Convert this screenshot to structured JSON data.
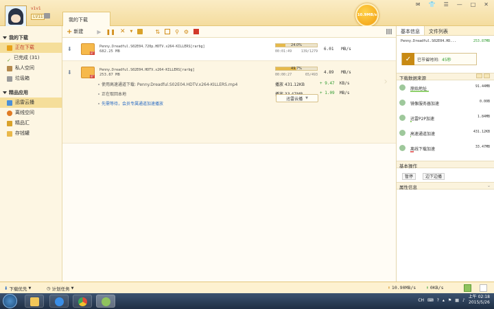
{
  "header": {
    "username": "v1v1",
    "level": "LV11",
    "tab_title": "我的下载",
    "speed_badge": "10.9MB/s",
    "window_controls": [
      "✉",
      "👕",
      "☰",
      "—",
      "□",
      "✕"
    ]
  },
  "sidebar": {
    "group_downloads": "我的下载",
    "items_downloads": [
      {
        "label": "正在下载",
        "active": true
      },
      {
        "label": "已完成 (31)",
        "active": false
      },
      {
        "label": "私人空间",
        "active": false
      },
      {
        "label": "垃圾箱",
        "active": false
      }
    ],
    "group_apps": "精品应用",
    "items_apps": [
      {
        "label": "迅雷云播",
        "active": true
      },
      {
        "label": "离线空间",
        "active": false
      },
      {
        "label": "精品汇",
        "active": false
      },
      {
        "label": "存钱罐",
        "active": false
      }
    ]
  },
  "toolbar": {
    "new_label": "新建"
  },
  "tasks": [
    {
      "name": "Penny.Dreadful.S02E04.720p.HDTV.x264-KILLERS[rarbg]",
      "size": "682.25 MB",
      "progress": 24.0,
      "percent_label": "24.0%",
      "elapsed": "00:01:49",
      "pieces": "139/1279",
      "speed_value": "6.01",
      "speed_unit": "MB/s"
    },
    {
      "name": "Penny.Dreadful.S02E04.HDTV.x264-KILLERS[rarbg]",
      "size": "253.87 MB",
      "progress": 49.7,
      "percent_label": "49.7%",
      "elapsed": "00:00:27",
      "pieces": "65/493",
      "speed_value": "4.89",
      "speed_unit": "MB/s",
      "sub_lines": [
        "使用高速通道下载: Penny.Dreadful.S02E04.HDTV.x264-KILLERS.mp4",
        "正在取回本地",
        "先需等待，会员专属通道加速播放"
      ],
      "accel_rows": [
        {
          "label": "播放 431.12KB",
          "plus": "+ 9.47",
          "unit": "KB/s"
        },
        {
          "label": "播放 33.47MB",
          "plus": "+ 1.09",
          "unit": "MB/s"
        }
      ],
      "cloud_button": "迅雷云播"
    }
  ],
  "right_panel": {
    "tab_basic": "基本信息",
    "tab_files": "文件列表",
    "file_name": "Penny.Dreadful.S02E04.HD...",
    "file_speed": "253.87MB",
    "saved_label": "已节省时间:",
    "saved_value": "45秒",
    "source_header": "下载数据来源",
    "sources": [
      {
        "name": "原始地址",
        "value": "91.44MB",
        "bar": 0.45,
        "color": "#8fd16b"
      },
      {
        "name": "镜像服务器加速",
        "value": "0.00B",
        "bar": 0.0,
        "color": "#8fd16b"
      },
      {
        "name": "迅雷P2P加速",
        "value": "1.84MB",
        "bar": 0.03,
        "color": "#8fd16b"
      },
      {
        "name": "高速通道加速",
        "value": "431.12KB",
        "bar": 0.01,
        "color": "#8fd16b"
      },
      {
        "name": "离线下载加速",
        "value": "33.47MB",
        "bar": 0.09,
        "color": "#e86b6b"
      }
    ],
    "ops_header": "基本操作",
    "pause_btn": "暂停",
    "play_btn": "边下边播",
    "attr_header": "属性信息"
  },
  "statusbar": {
    "priority": "下载优先",
    "schedule": "计划任务",
    "down_speed": "10.90MB/s",
    "up_speed": "0KB/s"
  },
  "taskbar": {
    "lang": "CH",
    "time": "上午 02:18",
    "date": "2015/5/26"
  }
}
